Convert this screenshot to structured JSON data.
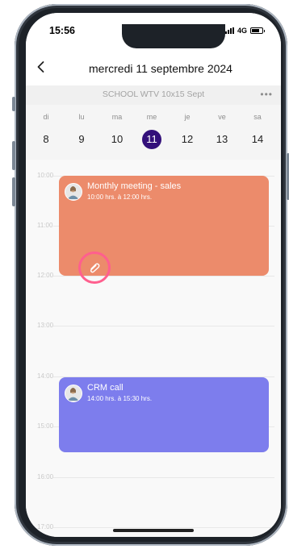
{
  "status_bar": {
    "time": "15:56",
    "network": "4G",
    "battery_level": 0.7
  },
  "header": {
    "title": "mercredi 11 septembre 2024",
    "back_icon": "chevron-left-icon"
  },
  "calendar": {
    "name": "SCHOOL WTV 10x15 Sept",
    "more_icon": "more-dots-icon",
    "more_label": "•••"
  },
  "week": {
    "days": [
      {
        "name": "di",
        "num": "8"
      },
      {
        "name": "lu",
        "num": "9"
      },
      {
        "name": "ma",
        "num": "10"
      },
      {
        "name": "me",
        "num": "11"
      },
      {
        "name": "je",
        "num": "12"
      },
      {
        "name": "ve",
        "num": "13"
      },
      {
        "name": "sa",
        "num": "14"
      }
    ],
    "selected_index": 3,
    "selected_color": "#33107a"
  },
  "hours": [
    "10:00",
    "11:00",
    "12:00",
    "13:00",
    "14:00",
    "15:00",
    "16:00",
    "17:00"
  ],
  "events": [
    {
      "title": "Monthly meeting - sales",
      "time": "10:00 hrs. à 12:00 hrs.",
      "color": "#ec8b6b",
      "attachment_icon": "paperclip-icon"
    },
    {
      "title": "CRM call",
      "time": "14:00 hrs. à 15:30 hrs.",
      "color": "#7d7ded"
    }
  ],
  "highlight_color": "#ff5f8e"
}
